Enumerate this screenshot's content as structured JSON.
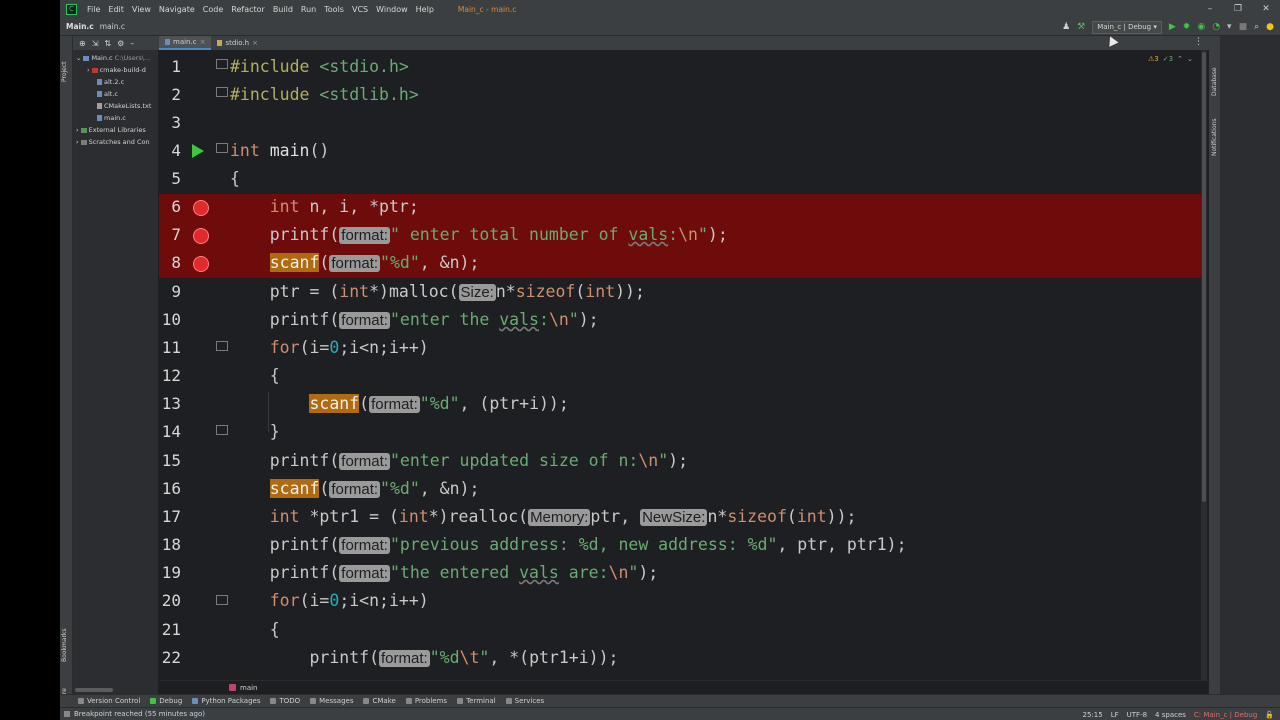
{
  "window": {
    "menu": [
      "File",
      "Edit",
      "View",
      "Navigate",
      "Code",
      "Refactor",
      "Build",
      "Run",
      "Tools",
      "VCS",
      "Window",
      "Help"
    ],
    "title": "Main_c - main.c",
    "controls": [
      "–",
      "❐",
      "✕"
    ]
  },
  "navbar": {
    "project": "Main.c",
    "file": "main.c",
    "run_config": "Main_c | Debug ▾"
  },
  "project_panel": {
    "root": "Main.c",
    "root_path": "C:\\Users\\...",
    "items": [
      "cmake-build-d",
      "alt.2.c",
      "alt.c",
      "CMakeLists.txt",
      "main.c"
    ],
    "external": "External Libraries",
    "scratches": "Scratches and Con"
  },
  "left_stripe": {
    "project": "Project",
    "bookmarks": "Bookmarks",
    "structure": "Structure"
  },
  "right_stripe": {
    "database": "Database",
    "notifications": "Notifications"
  },
  "tabs": [
    {
      "label": "main.c",
      "active": true
    },
    {
      "label": "stdio.h",
      "active": false
    }
  ],
  "inspections": {
    "warnings": "⚠3",
    "weak": "✓3"
  },
  "editor": {
    "line_numbers": [
      "1",
      "2",
      "3",
      "4",
      "5",
      "6",
      "7",
      "8",
      "9",
      "10",
      "11",
      "12",
      "13",
      "14",
      "15",
      "16",
      "17",
      "18",
      "19",
      "20",
      "21",
      "22"
    ],
    "breakpoint_lines": [
      6,
      7,
      8
    ],
    "run_line": 4,
    "fold_lines": [
      1,
      2,
      4,
      11,
      14,
      20
    ]
  },
  "breadcrumb": "main",
  "bottom_tools": [
    "Version Control",
    "Debug",
    "Python Packages",
    "TODO",
    "Messages",
    "CMake",
    "Problems",
    "Terminal",
    "Services"
  ],
  "status": {
    "message": "Breakpoint reached (55 minutes ago)",
    "position": "25:15",
    "line_sep": "LF",
    "encoding": "UTF-8",
    "indent": "4 spaces",
    "config": "C: Main_c | Debug"
  },
  "colors": {
    "editor_bg": "#1e1f22",
    "breakpoint_line": "#6e0b0b",
    "keyword": "#cf8e6d",
    "string": "#6aab73",
    "number": "#2aacb8",
    "highlight": "#b06a12"
  }
}
